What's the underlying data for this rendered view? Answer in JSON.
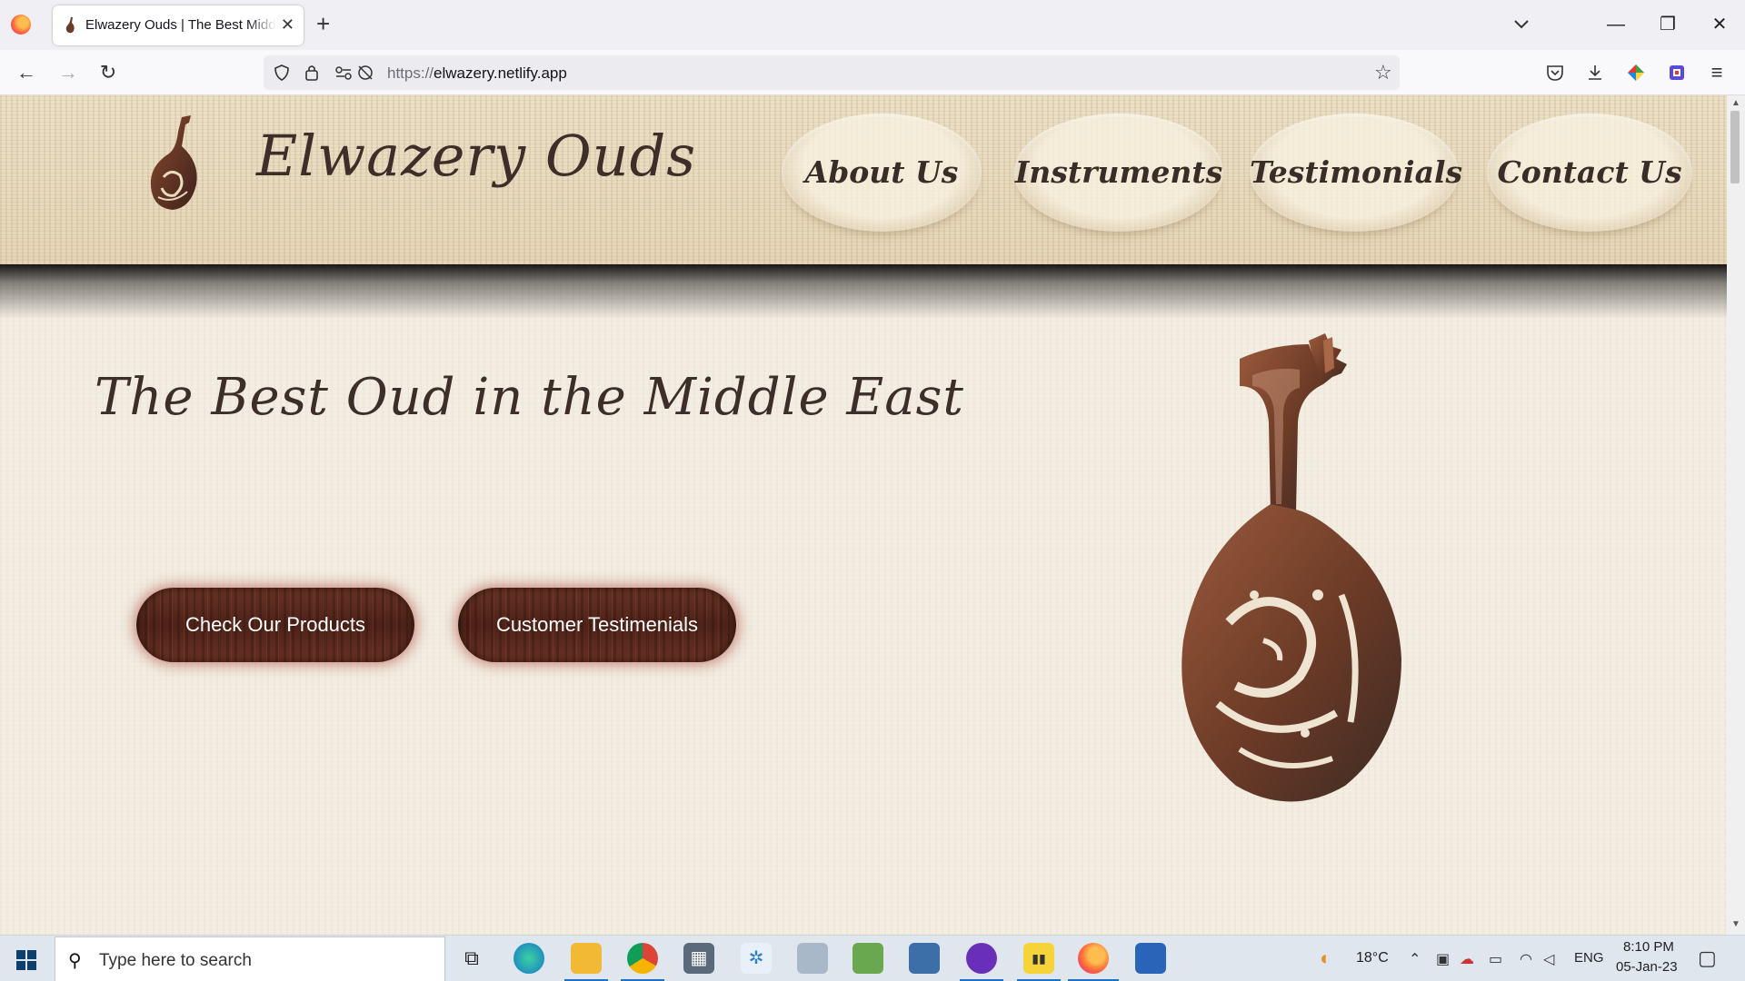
{
  "browser": {
    "tab_title": "Elwazery Ouds | The Best Middle East Ouds",
    "tab_close": "✕",
    "new_tab": "+",
    "url_protocol": "https://",
    "url_host": "elwazery.netlify.app",
    "window_controls": {
      "minimize": "—",
      "restore": "❐",
      "close": "✕"
    }
  },
  "site": {
    "brand": "Elwazery Ouds",
    "nav": [
      {
        "label": "About Us"
      },
      {
        "label": "Instruments"
      },
      {
        "label": "Testimonials"
      },
      {
        "label": "Contact Us"
      }
    ],
    "hero_title": "The Best Oud in the Middle East",
    "cta_products": "Check Our Products",
    "cta_testimonials": "Customer Testimenials"
  },
  "taskbar": {
    "search_placeholder": "Type here to search",
    "weather": "18°C",
    "language": "ENG",
    "time": "8:10 PM",
    "date": "05-Jan-23"
  },
  "colors": {
    "brand_text": "#3d2e29",
    "button_wood": "#5a2a1e",
    "button_glow": "#aa3c32",
    "page_bg": "#f3ede2",
    "header_bg": "#e9dbbe"
  }
}
